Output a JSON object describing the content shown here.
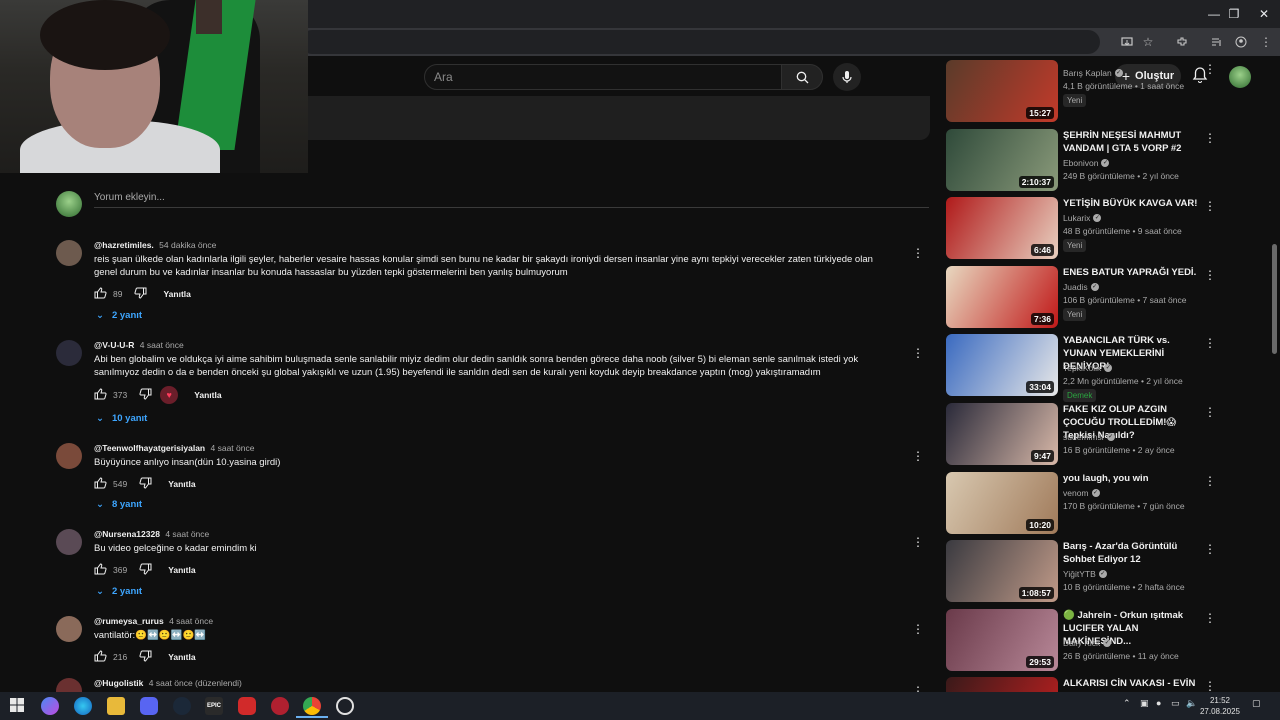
{
  "browser": {
    "window_controls": [
      "—",
      "❐",
      "✕"
    ]
  },
  "header": {
    "search_placeholder": "Ara",
    "create_label": "Oluştur"
  },
  "comments_section": {
    "add_comment_placeholder": "Yorum ekleyin...",
    "reply_label": "Yanıtla",
    "comments": [
      {
        "user": "@hazretimiles.",
        "time": "54 dakika önce",
        "text": "reis şuan ülkede olan kadınlarla ilgili şeyler, haberler vesaire hassas konular şimdi sen bunu ne kadar bir şakaydı ironiydi dersen insanlar yine aynı tepkiyi verecekler zaten türkiyede olan genel durum bu ve kadınlar insanlar bu konuda hassaslar bu yüzden tepki göstermelerini ben yanlış bulmuyorum",
        "likes": "89",
        "replies": "2 yanıt",
        "avatar_color": "#6d5a4e"
      },
      {
        "user": "@V-U-U-R",
        "time": "4 saat önce",
        "text": "Abi ben globalim ve oldukça iyi aime sahibim buluşmada senle sanlabilir miyiz dedim olur dedin sanldık sonra benden görece daha noob (silver 5) bi eleman senle sanılmak istedi yok sanılmıyoz dedin o da e benden önceki şu global yakışıklı ve uzun (1.95) beyefendi ile sanldın dedi sen de kuralı yeni koyduk deyip breakdance yaptın (mog) yakıştıramadım",
        "likes": "373",
        "replies": "10 yanıt",
        "avatar_color": "#2b2b3a"
      },
      {
        "user": "@Teenwolfhayatgerisiyalan",
        "time": "4 saat önce",
        "text": "Büyüyünce anlıyo insan(dün 10.yasina girdi)",
        "likes": "549",
        "replies": "8 yanıt",
        "avatar_color": "#7a4a3a"
      },
      {
        "user": "@Nursena12328",
        "time": "4 saat önce",
        "text": "Bu video gelceğine o kadar emindim ki",
        "likes": "369",
        "replies": "2 yanıt",
        "avatar_color": "#5a4a55"
      },
      {
        "user": "@rumeysa_rurus",
        "time": "4 saat önce",
        "text": "vantilatör:🙂↔️🙂↔️🙂↔️",
        "likes": "216",
        "replies": "",
        "avatar_color": "#8a6a5a"
      },
      {
        "user": "@Hugolistik",
        "time": "4 saat önce (düzenlendi)",
        "text": "",
        "likes": "",
        "replies": "",
        "avatar_color": "#6a3030"
      }
    ]
  },
  "sidebar": {
    "videos": [
      {
        "title": "",
        "channel": "Barış Kaplan",
        "meta": "4,1 B görüntüleme • 1 saat önce",
        "badge": "Yeni",
        "duration": "15:27",
        "thumb": [
          "#5a3b2a",
          "#c23a2a"
        ]
      },
      {
        "title": "ŞEHRİN NEŞESİ MAHMUT VANDAM | GTA 5 VORP #2",
        "channel": "Ebonivon",
        "meta": "249 B görüntüleme • 2 yıl önce",
        "badge": "",
        "duration": "2:10:37",
        "thumb": [
          "#2f4a3a",
          "#8a9a7a"
        ]
      },
      {
        "title": "YETİŞİN BÜYÜK KAVGA VAR!",
        "channel": "Lukarix",
        "meta": "48 B görüntüleme • 9 saat önce",
        "badge": "Yeni",
        "duration": "6:46",
        "thumb": [
          "#b01a1a",
          "#e8d0c0"
        ]
      },
      {
        "title": "ENES BATUR YAPRAĞI YEDİ.",
        "channel": "Juadis",
        "meta": "106 B görüntüleme • 7 saat önce",
        "badge": "Yeni",
        "duration": "7:36",
        "thumb": [
          "#e8d8c0",
          "#c01818"
        ]
      },
      {
        "title": "YABANCILAR TÜRK vs. YUNAN YEMEKLERİNİ DENİYOR!",
        "channel": "TepkiKolik",
        "meta": "2,2 Mn görüntüleme • 2 yıl önce",
        "badge": "Demek",
        "duration": "33:04",
        "thumb": [
          "#3a6ac0",
          "#e8e8e8"
        ]
      },
      {
        "title": "FAKE KIZ OLUP AZGIN ÇOCUĞU TROLLEDİM!😱 Tepkisi Nasıldı?",
        "channel": "sudemimsi",
        "meta": "16 B görüntüleme • 2 ay önce",
        "badge": "",
        "duration": "9:47",
        "thumb": [
          "#2a2a3a",
          "#d8b8a8"
        ]
      },
      {
        "title": "you laugh, you win",
        "channel": "venom",
        "meta": "170 B görüntüleme • 7 gün önce",
        "badge": "",
        "duration": "10:20",
        "thumb": [
          "#d8c8b0",
          "#a07a5a"
        ]
      },
      {
        "title": "Barış - Azar'da Görüntülü Sohbet Ediyor 12",
        "channel": "YiğitYTB",
        "meta": "10 B görüntüleme • 2 hafta önce",
        "badge": "",
        "duration": "1:08:57",
        "thumb": [
          "#3a3a40",
          "#c09a88"
        ]
      },
      {
        "title": "🟢 Jahrein - Orkun ışıtmak LUCIFER YALAN MAKİNESİND...",
        "channel": "Daily Kick",
        "meta": "26 B görüntüleme • 11 ay önce",
        "badge": "",
        "duration": "29:53",
        "thumb": [
          "#6a3a4a",
          "#b88898"
        ]
      },
      {
        "title": "ALKARISI CİN VAKASI - EVİN",
        "channel": "",
        "meta": "",
        "badge": "",
        "duration": "",
        "thumb": [
          "#3a1a1a",
          "#c02020"
        ]
      }
    ]
  },
  "taskbar": {
    "time": "21:52",
    "date": "27.08.2025"
  }
}
